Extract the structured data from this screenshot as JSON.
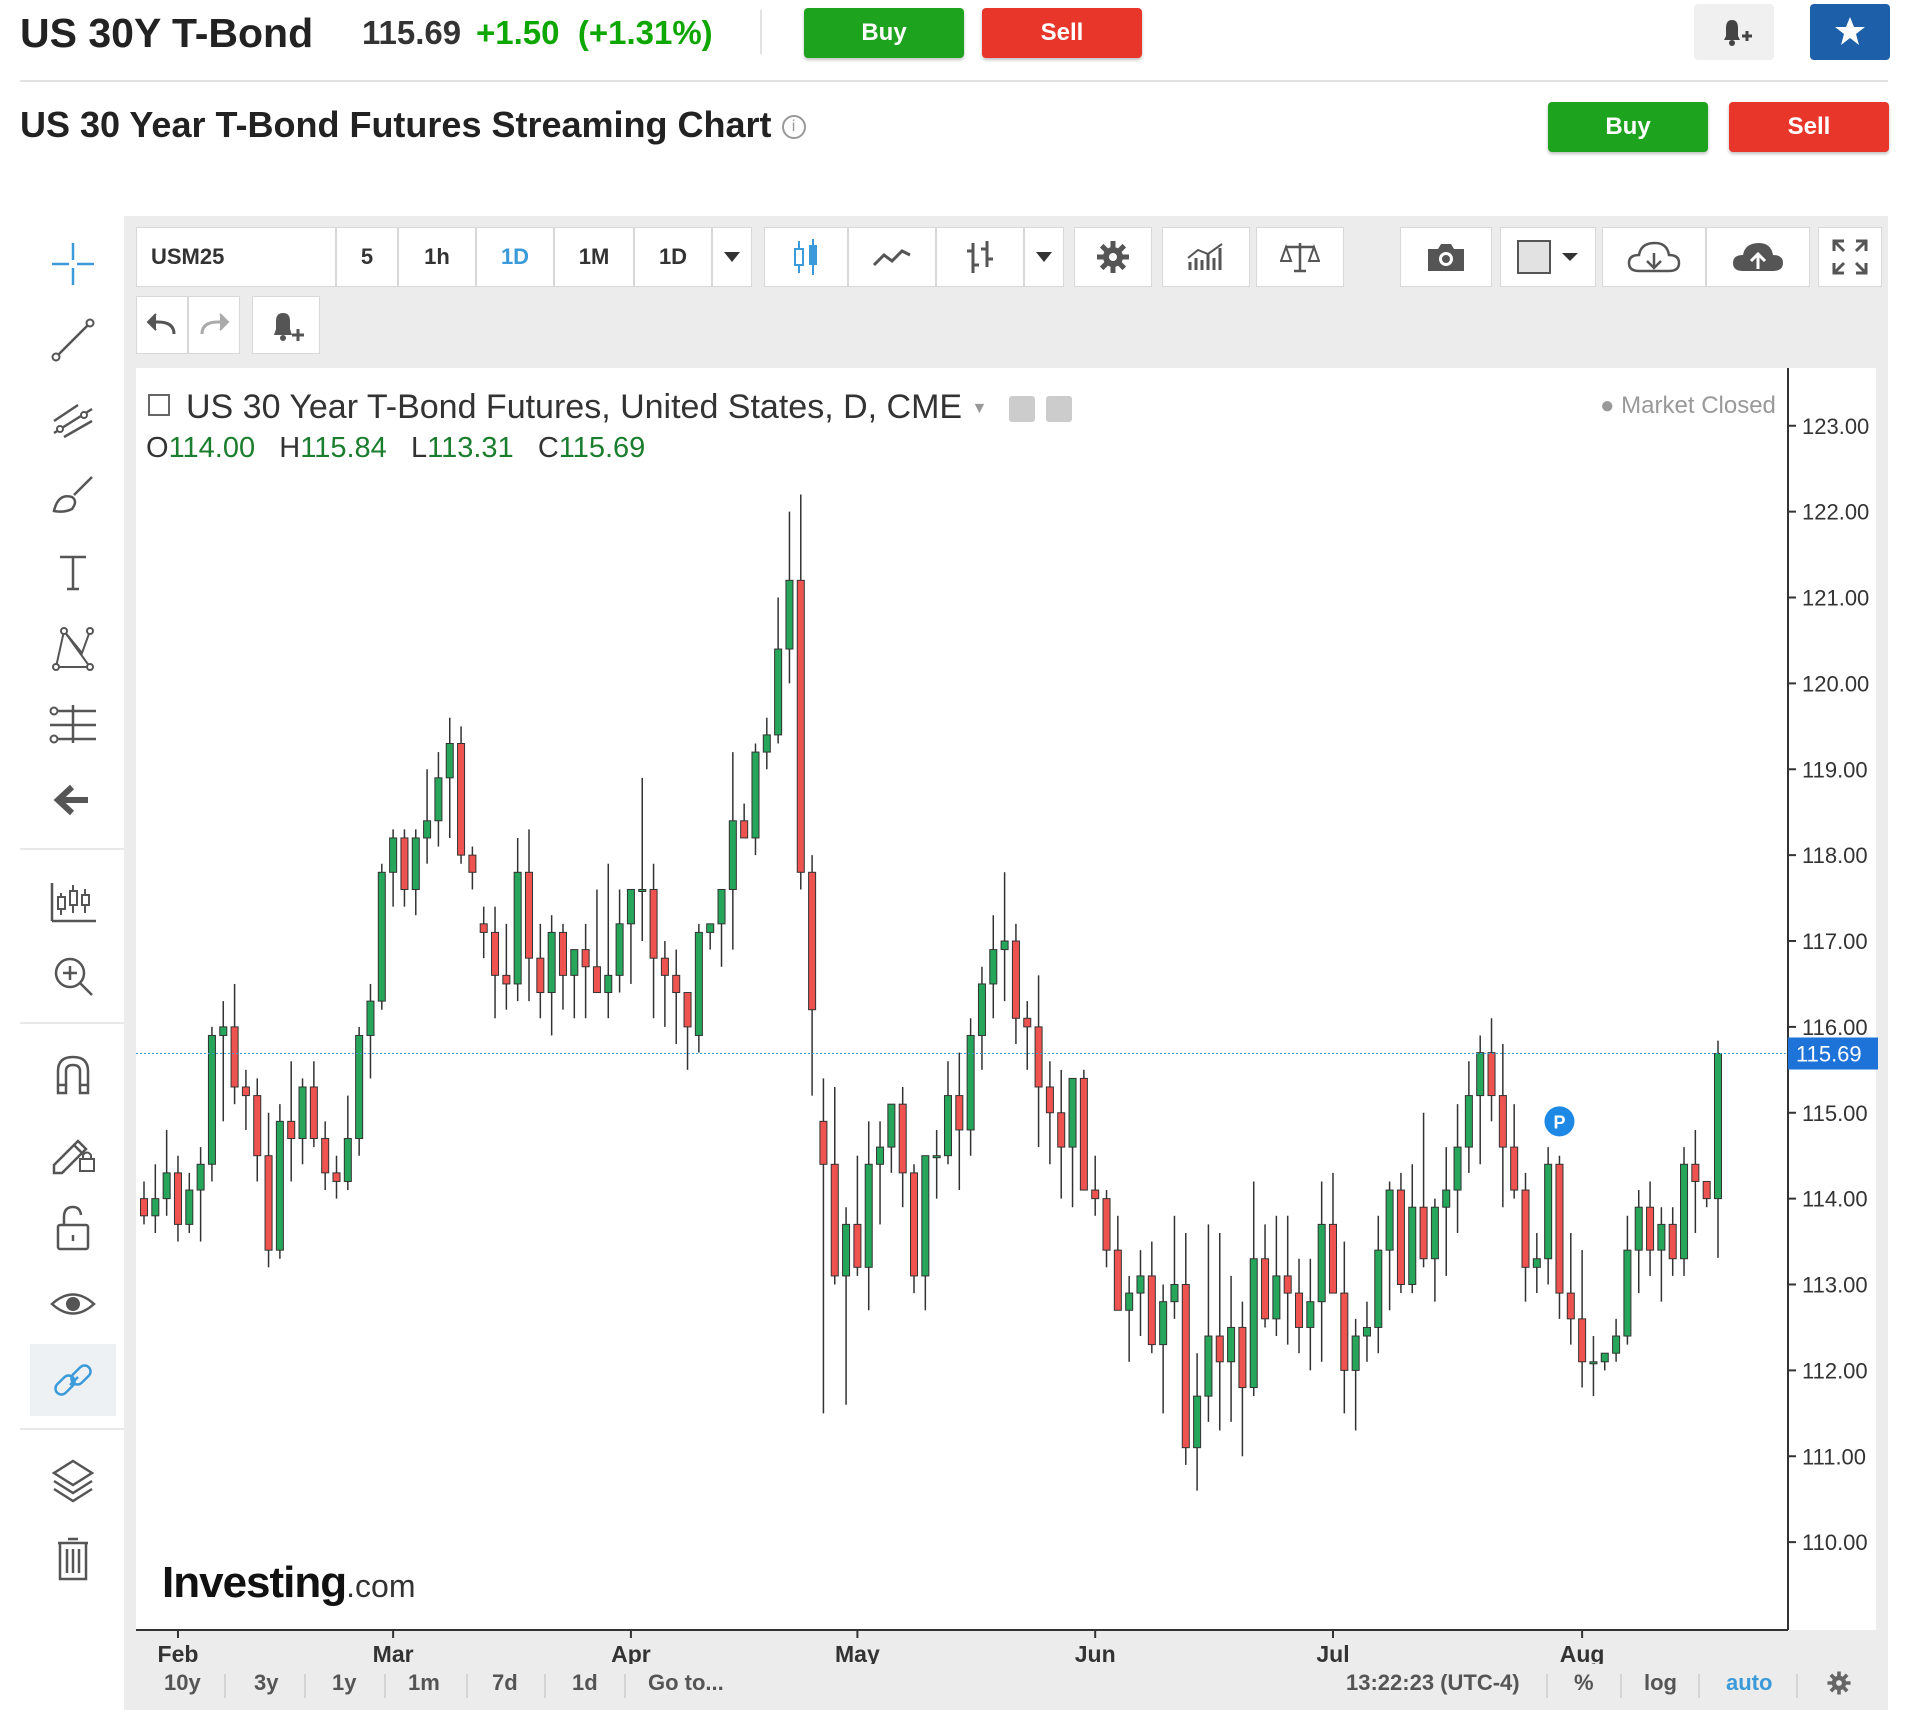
{
  "header": {
    "instrument": "US 30Y T-Bond",
    "price": "115.69",
    "change": "+1.50",
    "change_pct": "(+1.31%)",
    "buy_label": "Buy",
    "sell_label": "Sell",
    "alert_icon": "bell-plus-icon",
    "watchlist_icon": "star-icon"
  },
  "page": {
    "title": "US 30 Year T-Bond Futures Streaming Chart",
    "info_icon": "info-icon",
    "buy_label": "Buy",
    "sell_label": "Sell"
  },
  "left_tools": [
    {
      "name": "crosshair-icon"
    },
    {
      "name": "trend-line-icon"
    },
    {
      "name": "fib-tools-icon"
    },
    {
      "name": "brush-icon"
    },
    {
      "name": "text-tool-icon"
    },
    {
      "name": "pattern-tool-icon"
    },
    {
      "name": "prediction-tool-icon"
    },
    {
      "name": "back-arrow-icon"
    },
    {
      "name": "measure-icon"
    },
    {
      "name": "zoom-in-icon"
    },
    {
      "name": "magnet-icon"
    },
    {
      "name": "lock-drawing-icon"
    },
    {
      "name": "unlock-icon"
    },
    {
      "name": "eye-icon"
    },
    {
      "name": "link-icon"
    },
    {
      "name": "layers-icon"
    },
    {
      "name": "trash-icon"
    }
  ],
  "toolbar": {
    "symbol": "USM25",
    "intervals": [
      "5",
      "1h",
      "1D",
      "1M",
      "1D"
    ],
    "active_interval": "1D",
    "icons": [
      "candles-icon",
      "line-chart-icon",
      "indicator-icon",
      "settings-gear-icon",
      "studies-icon",
      "compare-icon",
      "camera-icon",
      "color-box-icon",
      "cloud-download-icon",
      "cloud-upload-icon",
      "fullscreen-icon"
    ],
    "row2_icons": [
      "undo-icon",
      "redo-icon",
      "alert-plus-icon"
    ]
  },
  "legend": {
    "title": "US 30 Year T-Bond Futures, United States, D, CME",
    "o_label": "O",
    "o": "114.00",
    "h_label": "H",
    "h": "115.84",
    "l_label": "L",
    "l": "113.31",
    "c_label": "C",
    "c": "115.69",
    "status": "Market Closed"
  },
  "watermark": {
    "brand": "Investing",
    "suffix": ".com"
  },
  "bottom_bar": {
    "ranges": [
      "10y",
      "3y",
      "1y",
      "1m",
      "7d",
      "1d"
    ],
    "goto": "Go to...",
    "time": "13:22:23 (UTC-4)",
    "percent": "%",
    "log": "log",
    "auto": "auto"
  },
  "colors": {
    "up": "#26a65b",
    "down": "#ef5350",
    "accent": "#3b9ad9",
    "buy": "#1ea31e",
    "sell": "#e8362b"
  },
  "chart_data": {
    "type": "candlestick",
    "title": "US 30 Year T-Bond Futures, United States, D, CME",
    "y_ticks": [
      "110.00",
      "111.00",
      "112.00",
      "113.00",
      "114.00",
      "115.00",
      "116.00",
      "117.00",
      "118.00",
      "119.00",
      "120.00",
      "121.00",
      "122.00",
      "123.00"
    ],
    "ylim": [
      109.0,
      123.3
    ],
    "x_ticks": [
      {
        "label": "Feb",
        "index": 3
      },
      {
        "label": "Mar",
        "index": 22
      },
      {
        "label": "Apr",
        "index": 43
      },
      {
        "label": "May",
        "index": 63
      },
      {
        "label": "Jun",
        "index": 84
      },
      {
        "label": "Jul",
        "index": 105
      },
      {
        "label": "Aug",
        "index": 127
      }
    ],
    "last_price": 115.69,
    "marker": {
      "label": "P",
      "index": 125,
      "price": 114.9
    },
    "candles": [
      {
        "o": 114.0,
        "h": 114.2,
        "l": 113.7,
        "c": 113.8
      },
      {
        "o": 113.8,
        "h": 114.4,
        "l": 113.6,
        "c": 114.0
      },
      {
        "o": 114.0,
        "h": 114.8,
        "l": 113.8,
        "c": 114.3
      },
      {
        "o": 114.3,
        "h": 114.5,
        "l": 113.5,
        "c": 113.7
      },
      {
        "o": 113.7,
        "h": 114.3,
        "l": 113.6,
        "c": 114.1
      },
      {
        "o": 114.1,
        "h": 114.6,
        "l": 113.5,
        "c": 114.4
      },
      {
        "o": 114.4,
        "h": 116.0,
        "l": 114.2,
        "c": 115.9
      },
      {
        "o": 115.9,
        "h": 116.3,
        "l": 114.9,
        "c": 116.0
      },
      {
        "o": 116.0,
        "h": 116.5,
        "l": 115.1,
        "c": 115.3
      },
      {
        "o": 115.3,
        "h": 115.5,
        "l": 114.8,
        "c": 115.2
      },
      {
        "o": 115.2,
        "h": 115.4,
        "l": 114.2,
        "c": 114.5
      },
      {
        "o": 114.5,
        "h": 115.0,
        "l": 113.2,
        "c": 113.4
      },
      {
        "o": 113.4,
        "h": 115.1,
        "l": 113.3,
        "c": 114.9
      },
      {
        "o": 114.9,
        "h": 115.6,
        "l": 114.2,
        "c": 114.7
      },
      {
        "o": 114.7,
        "h": 115.4,
        "l": 114.4,
        "c": 115.3
      },
      {
        "o": 115.3,
        "h": 115.6,
        "l": 114.6,
        "c": 114.7
      },
      {
        "o": 114.7,
        "h": 114.9,
        "l": 114.1,
        "c": 114.3
      },
      {
        "o": 114.3,
        "h": 114.5,
        "l": 114.0,
        "c": 114.2
      },
      {
        "o": 114.2,
        "h": 115.2,
        "l": 114.1,
        "c": 114.7
      },
      {
        "o": 114.7,
        "h": 116.0,
        "l": 114.5,
        "c": 115.9
      },
      {
        "o": 115.9,
        "h": 116.5,
        "l": 115.4,
        "c": 116.3
      },
      {
        "o": 116.3,
        "h": 117.9,
        "l": 116.2,
        "c": 117.8
      },
      {
        "o": 117.8,
        "h": 118.3,
        "l": 117.4,
        "c": 118.2
      },
      {
        "o": 118.2,
        "h": 118.3,
        "l": 117.4,
        "c": 117.6
      },
      {
        "o": 117.6,
        "h": 118.3,
        "l": 117.3,
        "c": 118.2
      },
      {
        "o": 118.2,
        "h": 119.0,
        "l": 117.9,
        "c": 118.4
      },
      {
        "o": 118.4,
        "h": 119.2,
        "l": 118.1,
        "c": 118.9
      },
      {
        "o": 118.9,
        "h": 119.6,
        "l": 118.2,
        "c": 119.3
      },
      {
        "o": 119.3,
        "h": 119.5,
        "l": 117.9,
        "c": 118.0
      },
      {
        "o": 118.0,
        "h": 118.1,
        "l": 117.6,
        "c": 117.8
      },
      {
        "o": 117.2,
        "h": 117.4,
        "l": 116.8,
        "c": 117.1
      },
      {
        "o": 117.1,
        "h": 117.4,
        "l": 116.1,
        "c": 116.6
      },
      {
        "o": 116.6,
        "h": 117.2,
        "l": 116.2,
        "c": 116.5
      },
      {
        "o": 116.5,
        "h": 118.2,
        "l": 116.3,
        "c": 117.8
      },
      {
        "o": 117.8,
        "h": 118.3,
        "l": 116.3,
        "c": 116.8
      },
      {
        "o": 116.8,
        "h": 117.2,
        "l": 116.1,
        "c": 116.4
      },
      {
        "o": 116.4,
        "h": 117.3,
        "l": 115.9,
        "c": 117.1
      },
      {
        "o": 117.1,
        "h": 117.2,
        "l": 116.2,
        "c": 116.6
      },
      {
        "o": 116.6,
        "h": 116.9,
        "l": 116.1,
        "c": 116.9
      },
      {
        "o": 116.9,
        "h": 117.2,
        "l": 116.1,
        "c": 116.7
      },
      {
        "o": 116.7,
        "h": 117.6,
        "l": 116.4,
        "c": 116.4
      },
      {
        "o": 116.4,
        "h": 117.9,
        "l": 116.1,
        "c": 116.6
      },
      {
        "o": 116.6,
        "h": 117.6,
        "l": 116.4,
        "c": 117.2
      },
      {
        "o": 117.2,
        "h": 117.4,
        "l": 116.5,
        "c": 117.6
      },
      {
        "o": 117.6,
        "h": 118.9,
        "l": 117.0,
        "c": 117.6
      },
      {
        "o": 117.6,
        "h": 117.9,
        "l": 116.1,
        "c": 116.8
      },
      {
        "o": 116.8,
        "h": 117.0,
        "l": 116.0,
        "c": 116.6
      },
      {
        "o": 116.6,
        "h": 116.9,
        "l": 115.8,
        "c": 116.4
      },
      {
        "o": 116.4,
        "h": 116.4,
        "l": 115.5,
        "c": 116.0
      },
      {
        "o": 115.9,
        "h": 117.2,
        "l": 115.7,
        "c": 117.1
      },
      {
        "o": 117.1,
        "h": 117.2,
        "l": 116.9,
        "c": 117.2
      },
      {
        "o": 117.2,
        "h": 117.6,
        "l": 116.7,
        "c": 117.6
      },
      {
        "o": 117.6,
        "h": 119.2,
        "l": 116.9,
        "c": 118.4
      },
      {
        "o": 118.4,
        "h": 118.6,
        "l": 118.2,
        "c": 118.2
      },
      {
        "o": 118.2,
        "h": 119.3,
        "l": 118.0,
        "c": 119.2
      },
      {
        "o": 119.2,
        "h": 119.6,
        "l": 119.0,
        "c": 119.4
      },
      {
        "o": 119.4,
        "h": 121.0,
        "l": 119.3,
        "c": 120.4
      },
      {
        "o": 120.4,
        "h": 122.0,
        "l": 120.0,
        "c": 121.2
      },
      {
        "o": 121.2,
        "h": 122.2,
        "l": 117.6,
        "c": 117.8
      },
      {
        "o": 117.8,
        "h": 118.0,
        "l": 115.2,
        "c": 116.2
      }
    ],
    "candles_b": [
      {
        "o": 114.9,
        "h": 115.4,
        "l": 111.5,
        "c": 114.4
      },
      {
        "o": 114.4,
        "h": 115.3,
        "l": 113.0,
        "c": 113.1
      },
      {
        "o": 113.1,
        "h": 113.9,
        "l": 111.6,
        "c": 113.7
      },
      {
        "o": 113.7,
        "h": 114.5,
        "l": 113.1,
        "c": 113.2
      },
      {
        "o": 113.2,
        "h": 114.9,
        "l": 112.7,
        "c": 114.4
      },
      {
        "o": 114.4,
        "h": 114.9,
        "l": 113.7,
        "c": 114.6
      },
      {
        "o": 114.6,
        "h": 115.1,
        "l": 114.3,
        "c": 115.1
      },
      {
        "o": 115.1,
        "h": 115.3,
        "l": 113.9,
        "c": 114.3
      },
      {
        "o": 114.3,
        "h": 114.4,
        "l": 112.9,
        "c": 113.1
      },
      {
        "o": 113.1,
        "h": 114.4,
        "l": 112.7,
        "c": 114.5
      },
      {
        "o": 114.5,
        "h": 114.8,
        "l": 114.0,
        "c": 114.5
      },
      {
        "o": 114.5,
        "h": 115.6,
        "l": 114.4,
        "c": 115.2
      },
      {
        "o": 115.2,
        "h": 115.7,
        "l": 114.1,
        "c": 114.8
      },
      {
        "o": 114.8,
        "h": 116.1,
        "l": 114.5,
        "c": 115.9
      },
      {
        "o": 115.9,
        "h": 116.7,
        "l": 115.5,
        "c": 116.5
      },
      {
        "o": 116.5,
        "h": 117.3,
        "l": 116.1,
        "c": 116.9
      },
      {
        "o": 116.9,
        "h": 117.8,
        "l": 116.3,
        "c": 117.0
      },
      {
        "o": 117.0,
        "h": 117.2,
        "l": 115.8,
        "c": 116.1
      },
      {
        "o": 116.1,
        "h": 116.3,
        "l": 115.5,
        "c": 116.0
      },
      {
        "o": 116.0,
        "h": 116.6,
        "l": 114.6,
        "c": 115.3
      },
      {
        "o": 115.3,
        "h": 115.6,
        "l": 114.4,
        "c": 115.0
      },
      {
        "o": 115.0,
        "h": 115.5,
        "l": 114.0,
        "c": 114.6
      },
      {
        "o": 114.6,
        "h": 115.4,
        "l": 113.9,
        "c": 115.4
      },
      {
        "o": 115.4,
        "h": 115.5,
        "l": 114.3,
        "c": 114.1
      },
      {
        "o": 114.1,
        "h": 114.5,
        "l": 113.8,
        "c": 114.0
      },
      {
        "o": 114.0,
        "h": 114.1,
        "l": 113.2,
        "c": 113.4
      },
      {
        "o": 113.4,
        "h": 113.8,
        "l": 112.7,
        "c": 112.7
      },
      {
        "o": 112.7,
        "h": 113.1,
        "l": 112.1,
        "c": 112.9
      },
      {
        "o": 112.9,
        "h": 113.4,
        "l": 112.4,
        "c": 113.1
      },
      {
        "o": 113.1,
        "h": 113.5,
        "l": 112.2,
        "c": 112.3
      },
      {
        "o": 112.3,
        "h": 113.0,
        "l": 111.5,
        "c": 112.8
      },
      {
        "o": 112.8,
        "h": 113.8,
        "l": 112.6,
        "c": 113.0
      },
      {
        "o": 113.0,
        "h": 113.6,
        "l": 110.9,
        "c": 111.1
      },
      {
        "o": 111.1,
        "h": 112.2,
        "l": 110.6,
        "c": 111.7
      },
      {
        "o": 111.7,
        "h": 113.7,
        "l": 111.4,
        "c": 112.4
      },
      {
        "o": 112.4,
        "h": 113.6,
        "l": 111.3,
        "c": 112.1
      },
      {
        "o": 112.1,
        "h": 113.1,
        "l": 111.4,
        "c": 112.5
      },
      {
        "o": 112.5,
        "h": 112.8,
        "l": 111.0,
        "c": 111.8
      },
      {
        "o": 111.8,
        "h": 114.2,
        "l": 111.7,
        "c": 113.3
      },
      {
        "o": 113.3,
        "h": 113.7,
        "l": 112.5,
        "c": 112.6
      },
      {
        "o": 112.6,
        "h": 113.8,
        "l": 112.4,
        "c": 113.1
      },
      {
        "o": 113.1,
        "h": 113.8,
        "l": 112.3,
        "c": 112.9
      },
      {
        "o": 112.9,
        "h": 113.3,
        "l": 112.2,
        "c": 112.5
      },
      {
        "o": 112.5,
        "h": 113.3,
        "l": 112.0,
        "c": 112.8
      }
    ],
    "candles_c": [
      {
        "o": 112.8,
        "h": 114.2,
        "l": 112.1,
        "c": 113.7
      },
      {
        "o": 113.7,
        "h": 114.3,
        "l": 113.0,
        "c": 112.9
      },
      {
        "o": 112.9,
        "h": 113.5,
        "l": 111.5,
        "c": 112.0
      },
      {
        "o": 112.0,
        "h": 112.6,
        "l": 111.3,
        "c": 112.4
      },
      {
        "o": 112.4,
        "h": 112.8,
        "l": 112.1,
        "c": 112.5
      },
      {
        "o": 112.5,
        "h": 113.8,
        "l": 112.2,
        "c": 113.4
      },
      {
        "o": 113.4,
        "h": 114.2,
        "l": 112.7,
        "c": 114.1
      },
      {
        "o": 114.1,
        "h": 114.3,
        "l": 112.9,
        "c": 113.0
      },
      {
        "o": 113.0,
        "h": 114.4,
        "l": 112.9,
        "c": 113.9
      },
      {
        "o": 113.9,
        "h": 115.0,
        "l": 113.2,
        "c": 113.3
      },
      {
        "o": 113.3,
        "h": 114.0,
        "l": 112.8,
        "c": 113.9
      },
      {
        "o": 113.9,
        "h": 114.6,
        "l": 113.1,
        "c": 114.1
      },
      {
        "o": 114.1,
        "h": 115.1,
        "l": 113.6,
        "c": 114.6
      },
      {
        "o": 114.6,
        "h": 115.6,
        "l": 114.3,
        "c": 115.2
      },
      {
        "o": 115.2,
        "h": 115.9,
        "l": 114.4,
        "c": 115.7
      },
      {
        "o": 115.7,
        "h": 116.1,
        "l": 114.9,
        "c": 115.2
      },
      {
        "o": 115.2,
        "h": 115.8,
        "l": 113.9,
        "c": 114.6
      },
      {
        "o": 114.6,
        "h": 115.1,
        "l": 114.0,
        "c": 114.1
      },
      {
        "o": 114.1,
        "h": 114.3,
        "l": 112.8,
        "c": 113.2
      },
      {
        "o": 113.2,
        "h": 113.6,
        "l": 112.9,
        "c": 113.3
      },
      {
        "o": 113.3,
        "h": 114.6,
        "l": 113.0,
        "c": 114.4
      },
      {
        "o": 114.4,
        "h": 114.5,
        "l": 112.6,
        "c": 112.9
      },
      {
        "o": 112.9,
        "h": 113.6,
        "l": 112.3,
        "c": 112.6
      },
      {
        "o": 112.6,
        "h": 113.4,
        "l": 111.8,
        "c": 112.1
      },
      {
        "o": 112.1,
        "h": 112.4,
        "l": 111.7,
        "c": 112.1
      },
      {
        "o": 112.1,
        "h": 112.2,
        "l": 112.0,
        "c": 112.2
      },
      {
        "o": 112.2,
        "h": 112.6,
        "l": 112.1,
        "c": 112.4
      },
      {
        "o": 112.4,
        "h": 113.8,
        "l": 112.3,
        "c": 113.4
      },
      {
        "o": 113.4,
        "h": 114.1,
        "l": 112.9,
        "c": 113.9
      },
      {
        "o": 113.9,
        "h": 114.2,
        "l": 113.1,
        "c": 113.4
      },
      {
        "o": 113.4,
        "h": 113.9,
        "l": 112.8,
        "c": 113.7
      },
      {
        "o": 113.7,
        "h": 113.9,
        "l": 113.1,
        "c": 113.3
      },
      {
        "o": 113.3,
        "h": 114.6,
        "l": 113.1,
        "c": 114.4
      },
      {
        "o": 114.4,
        "h": 114.8,
        "l": 113.6,
        "c": 114.2
      },
      {
        "o": 114.2,
        "h": 114.2,
        "l": 113.9,
        "c": 114.0
      },
      {
        "o": 114.0,
        "h": 115.84,
        "l": 113.31,
        "c": 115.69
      }
    ]
  }
}
